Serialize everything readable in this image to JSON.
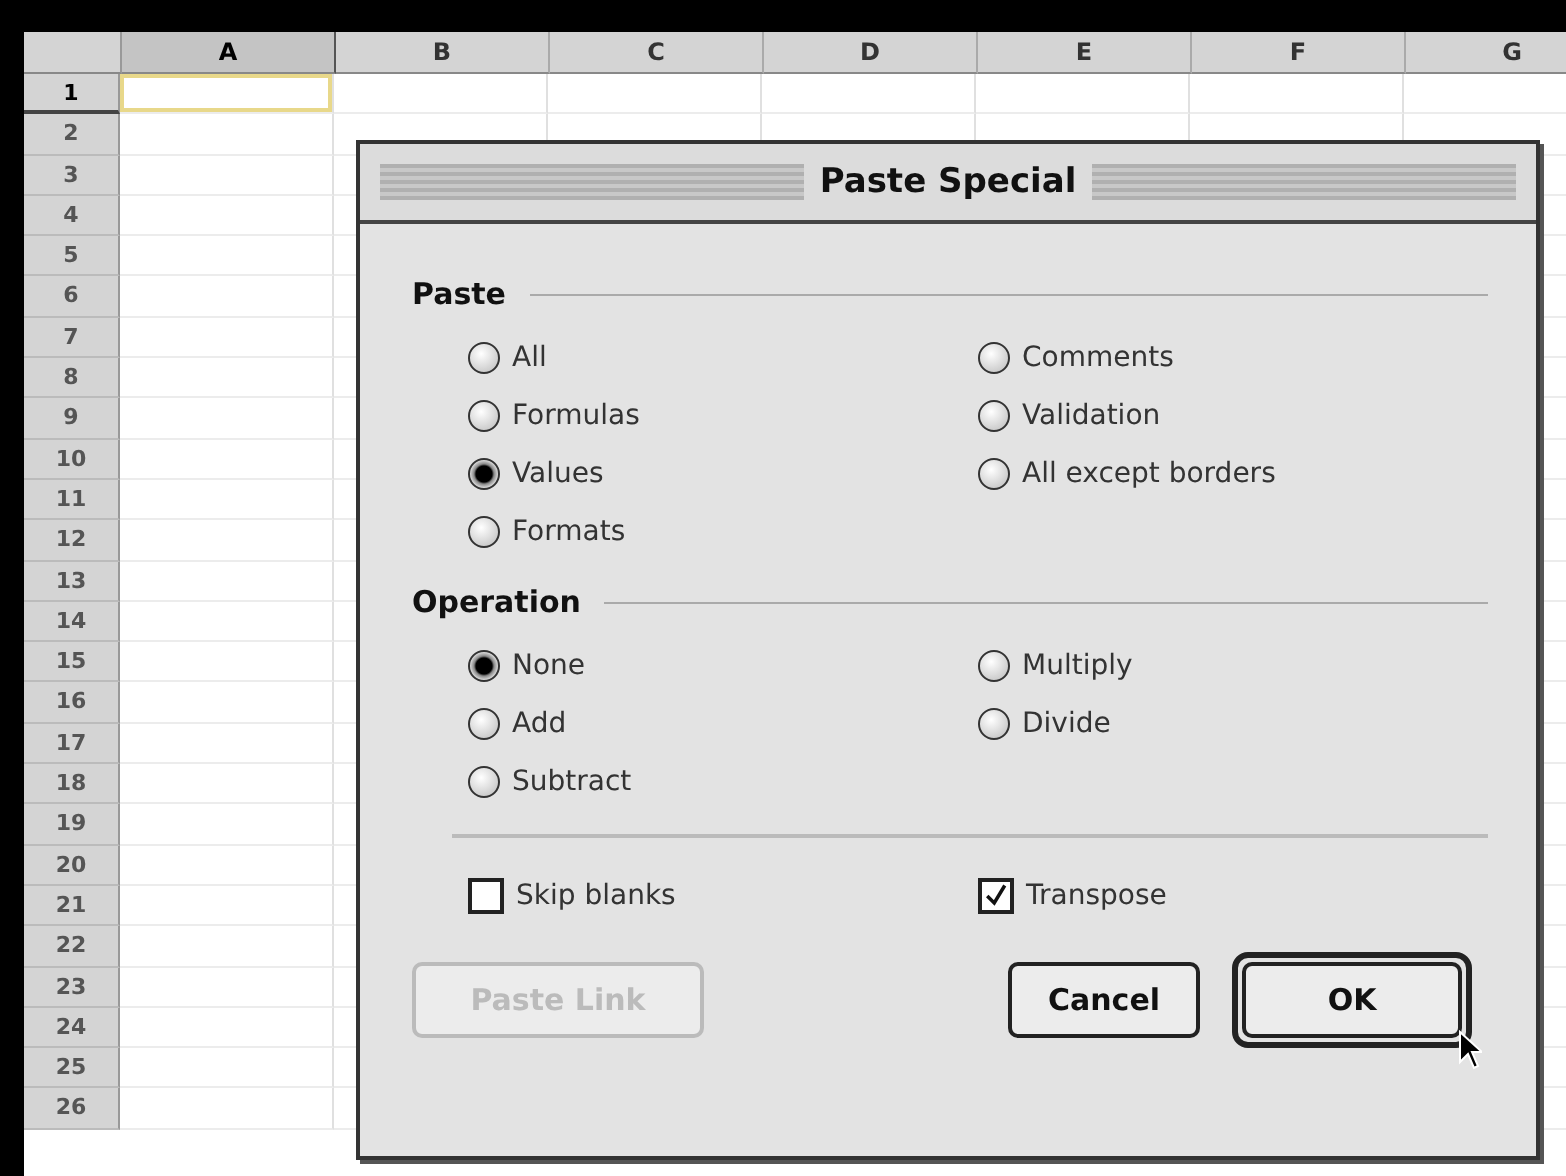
{
  "sheet": {
    "columns": [
      {
        "label": "A",
        "selected": true
      },
      {
        "label": "B",
        "selected": false
      },
      {
        "label": "C",
        "selected": false
      },
      {
        "label": "D",
        "selected": false
      },
      {
        "label": "E",
        "selected": false
      },
      {
        "label": "F",
        "selected": false
      },
      {
        "label": "G",
        "selected": false
      }
    ],
    "rows": [
      {
        "label": "1",
        "selected": true
      },
      {
        "label": "2",
        "selected": false
      },
      {
        "label": "3",
        "selected": false
      },
      {
        "label": "4",
        "selected": false
      },
      {
        "label": "5",
        "selected": false
      },
      {
        "label": "6",
        "selected": false
      },
      {
        "label": "7",
        "selected": false
      },
      {
        "label": "8",
        "selected": false
      },
      {
        "label": "9",
        "selected": false
      },
      {
        "label": "10",
        "selected": false
      },
      {
        "label": "11",
        "selected": false
      },
      {
        "label": "12",
        "selected": false
      },
      {
        "label": "13",
        "selected": false
      },
      {
        "label": "14",
        "selected": false
      },
      {
        "label": "15",
        "selected": false
      },
      {
        "label": "16",
        "selected": false
      },
      {
        "label": "17",
        "selected": false
      },
      {
        "label": "18",
        "selected": false
      },
      {
        "label": "19",
        "selected": false
      },
      {
        "label": "20",
        "selected": false
      },
      {
        "label": "21",
        "selected": false
      },
      {
        "label": "22",
        "selected": false
      },
      {
        "label": "23",
        "selected": false
      },
      {
        "label": "24",
        "selected": false
      },
      {
        "label": "25",
        "selected": false
      },
      {
        "label": "26",
        "selected": false
      }
    ]
  },
  "dialog": {
    "title": "Paste Special",
    "groups": [
      {
        "label": "Paste",
        "columns": [
          [
            {
              "label": "All",
              "selected": false
            },
            {
              "label": "Formulas",
              "selected": false
            },
            {
              "label": "Values",
              "selected": true
            },
            {
              "label": "Formats",
              "selected": false
            }
          ],
          [
            {
              "label": "Comments",
              "selected": false
            },
            {
              "label": "Validation",
              "selected": false
            },
            {
              "label": "All except borders",
              "selected": false
            }
          ]
        ]
      },
      {
        "label": "Operation",
        "columns": [
          [
            {
              "label": "None",
              "selected": true
            },
            {
              "label": "Add",
              "selected": false
            },
            {
              "label": "Subtract",
              "selected": false
            }
          ],
          [
            {
              "label": "Multiply",
              "selected": false
            },
            {
              "label": "Divide",
              "selected": false
            }
          ]
        ]
      }
    ],
    "checkboxes": [
      {
        "label": "Skip blanks",
        "checked": false
      },
      {
        "label": "Transpose",
        "checked": true
      }
    ],
    "buttons": [
      {
        "label": "Paste Link",
        "disabled": true,
        "default": false
      },
      {
        "label": "Cancel",
        "disabled": false,
        "default": false
      },
      {
        "label": "OK",
        "disabled": false,
        "default": true
      }
    ]
  }
}
